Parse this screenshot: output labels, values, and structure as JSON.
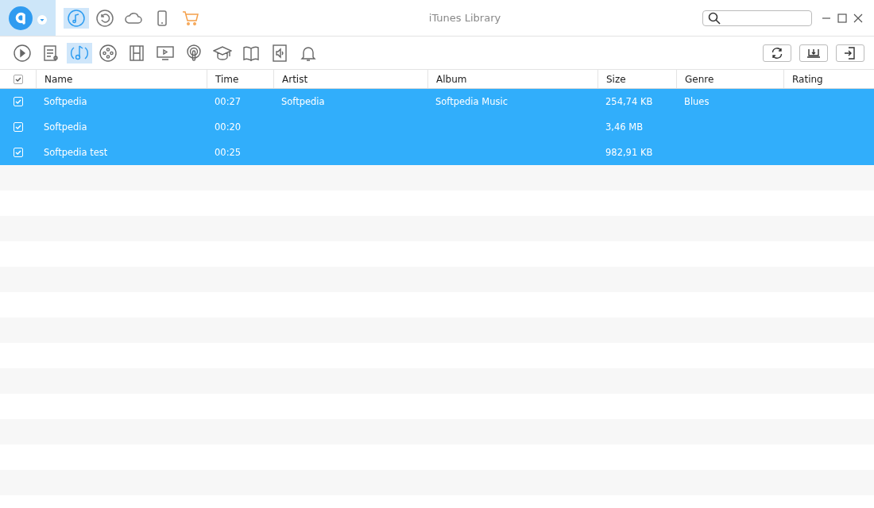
{
  "window": {
    "title": "iTunes Library"
  },
  "nav_tabs": [
    {
      "selected": true
    },
    {
      "selected": false
    },
    {
      "selected": false
    },
    {
      "selected": false
    },
    {
      "selected": false
    }
  ],
  "categories": [
    {
      "selected": false
    },
    {
      "selected": false
    },
    {
      "selected": true
    },
    {
      "selected": false
    },
    {
      "selected": false
    },
    {
      "selected": false
    },
    {
      "selected": false
    },
    {
      "selected": false
    },
    {
      "selected": false
    },
    {
      "selected": false
    },
    {
      "selected": false
    }
  ],
  "table": {
    "select_all": {
      "checked": true
    },
    "columns": [
      "Name",
      "Time",
      "Artist",
      "Album",
      "Size",
      "Genre",
      "Rating"
    ],
    "rows": [
      {
        "checked": true,
        "selected": true,
        "cells": [
          "Softpedia",
          "00:27",
          "Softpedia",
          "Softpedia Music",
          "254,74 KB",
          "Blues",
          ""
        ]
      },
      {
        "checked": true,
        "selected": true,
        "cells": [
          "Softpedia",
          "00:20",
          "",
          "",
          "3,46 MB",
          "",
          ""
        ]
      },
      {
        "checked": true,
        "selected": true,
        "cells": [
          "Softpedia test",
          "00:25",
          "",
          "",
          "982,91 KB",
          "",
          ""
        ]
      }
    ]
  }
}
